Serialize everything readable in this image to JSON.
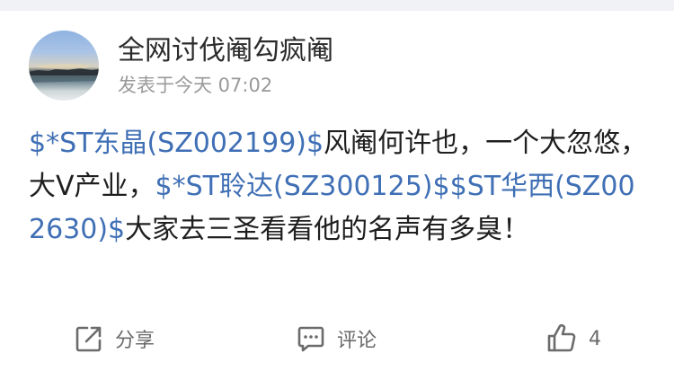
{
  "post": {
    "username": "全网讨伐阉勾疯阉",
    "timestamp": "发表于今天 07:02",
    "content": [
      {
        "type": "stock",
        "text": "$*ST东晶(SZ002199)$"
      },
      {
        "type": "text",
        "text": "风阉何许也，一个大忽悠，大V产业，"
      },
      {
        "type": "stock",
        "text": "$*ST聆达(SZ300125)$"
      },
      {
        "type": "stock",
        "text": "$ST华西(SZ002630)$"
      },
      {
        "type": "text",
        "text": "大家去三圣看看他的名声有多臭！"
      }
    ]
  },
  "actions": {
    "share_label": "分享",
    "comment_label": "评论",
    "like_count": "4",
    "share_icon": "share-icon",
    "comment_icon": "comment-icon",
    "like_icon": "thumbs-up-icon"
  },
  "colors": {
    "stock_link": "#3f6fb5",
    "meta_text": "#9a9a9a",
    "top_band": "#f1f2f5"
  }
}
